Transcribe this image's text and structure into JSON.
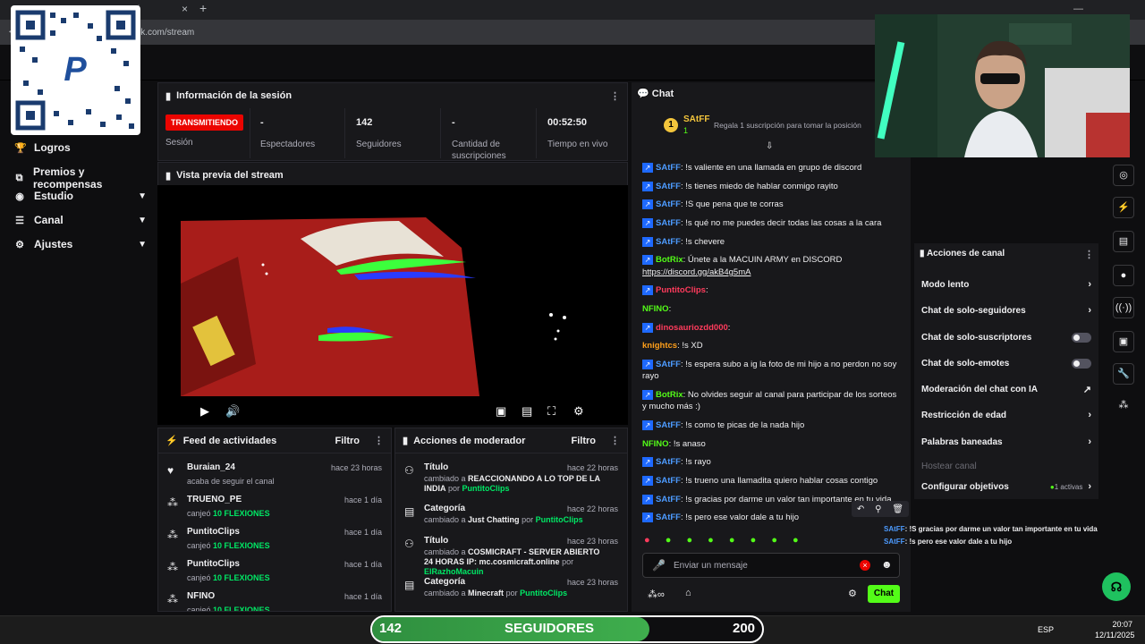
{
  "browser": {
    "url": "ick.com/stream",
    "tab_fragment": "rd"
  },
  "sidebar": {
    "items": [
      {
        "label": "Logros",
        "icon": "trophy-icon"
      },
      {
        "label": "Premios y recompensas",
        "icon": "gift-icon"
      },
      {
        "label": "Estudio",
        "icon": "studio-icon"
      },
      {
        "label": "Canal",
        "icon": "channel-icon"
      },
      {
        "label": "Ajustes",
        "icon": "gear-icon"
      }
    ]
  },
  "session": {
    "title": "Información de la sesión",
    "badge": "TRANSMITIENDO",
    "badge_label": "Sesión",
    "viewers_val": "-",
    "viewers_lbl": "Espectadores",
    "followers_val": "142",
    "followers_lbl": "Seguidores",
    "subs_val": "-",
    "subs_lbl": "Cantidad de suscripciones",
    "live_val": "00:52:50",
    "live_lbl": "Tiempo en vivo"
  },
  "preview": {
    "title": "Vista previa del stream"
  },
  "activity": {
    "title": "Feed de actividades",
    "filter": "Filtro",
    "rows": [
      {
        "name": "Buraian_24",
        "desc": "acaba de seguir el canal",
        "hl": "",
        "time": "hace 23 horas",
        "icon": "heart-icon"
      },
      {
        "name": "TRUENO_PE",
        "desc": "canjeó",
        "hl": "10 FLEXIONES",
        "time": "hace 1 día",
        "icon": "points-icon"
      },
      {
        "name": "PuntitoClips",
        "desc": "canjeó",
        "hl": "10 FLEXIONES",
        "time": "hace 1 día",
        "icon": "points-icon"
      },
      {
        "name": "PuntitoClips",
        "desc": "canjeó",
        "hl": "10 FLEXIONES",
        "time": "hace 1 día",
        "icon": "points-icon"
      },
      {
        "name": "NFINO",
        "desc": "canjeó",
        "hl": "10 FLEXIONES",
        "time": "hace 1 día",
        "icon": "points-icon"
      }
    ]
  },
  "modactions": {
    "title": "Acciones de moderador",
    "filter": "Filtro",
    "rows": [
      {
        "name": "Título",
        "l1": "cambiado a",
        "v1": "REACCIONANDO A LO TOP DE LA INDIA",
        "l2": "por",
        "v2": "PuntitoClips",
        "time": "hace 22 horas"
      },
      {
        "name": "Categoría",
        "l1": "cambiado a",
        "v1": "Just Chatting",
        "l2": "por",
        "v2": "PuntitoClips",
        "time": "hace 22 horas"
      },
      {
        "name": "Título",
        "l1": "cambiado a",
        "v1": "COSMICRAFT - SERVER ABIERTO 24 HORAS IP: mc.cosmicraft.online",
        "l2": "por",
        "v2": "ElRazhoMacuin",
        "time": "hace 23 horas"
      },
      {
        "name": "Categoría",
        "l1": "cambiado a",
        "v1": "Minecraft",
        "l2": "por",
        "v2": "PuntitoClips",
        "time": "hace 23 horas"
      }
    ]
  },
  "chat": {
    "title": "Chat",
    "pinned_user": "SAtFF",
    "pinned_count": "1",
    "gift_text": "Regala 1 suscripción para tomar la posición",
    "messages": [
      {
        "user": "SAtFF",
        "color": "#4d9bff",
        "text": "!s valiente en una llamada en grupo de discord"
      },
      {
        "user": "SAtFF",
        "color": "#4d9bff",
        "text": "!s tienes miedo de hablar conmigo rayito"
      },
      {
        "user": "SAtFF",
        "color": "#4d9bff",
        "text": "!S que pena que te corras"
      },
      {
        "user": "SAtFF",
        "color": "#4d9bff",
        "text": "!s qué no me puedes decir todas las cosas a la cara"
      },
      {
        "user": "SAtFF",
        "color": "#4d9bff",
        "text": "!s chevere"
      },
      {
        "user": "BotRix",
        "color": "#53fc18",
        "text": "Únete a la MACUIN ARMY en DISCORD"
      },
      {
        "user": "",
        "color": "#efeff1",
        "text": "https://discord.gg/akB4g5mA"
      },
      {
        "user": "PuntitoClips",
        "color": "#ff3b5c",
        "text": ""
      },
      {
        "user": "NFINO",
        "color": "#53fc18",
        "text": ""
      },
      {
        "user": "dinosauriozdd000",
        "color": "#ff3b5c",
        "text": ""
      },
      {
        "user": "knightcs",
        "color": "#ff9f1a",
        "text": "!s XD"
      },
      {
        "user": "SAtFF",
        "color": "#4d9bff",
        "text": "!s espera subo a ig la foto de mi hijo a no perdon no soy rayo"
      },
      {
        "user": "BotRix",
        "color": "#53fc18",
        "text": "No olvides seguir al canal para participar de los sorteos y mucho más :)"
      },
      {
        "user": "SAtFF",
        "color": "#4d9bff",
        "text": "!s como te picas de la nada hijo"
      },
      {
        "user": "NFINO",
        "color": "#53fc18",
        "text": "!s anaso"
      },
      {
        "user": "SAtFF",
        "color": "#4d9bff",
        "text": "!s rayo"
      },
      {
        "user": "SAtFF",
        "color": "#4d9bff",
        "text": "!s trueno una llamadita quiero hablar cosas contigo"
      },
      {
        "user": "SAtFF",
        "color": "#4d9bff",
        "text": "!s gracias por darme un valor tan importante en tu vida"
      },
      {
        "user": "SAtFF",
        "color": "#4d9bff",
        "text": "!s pero ese valor dale a tu hijo"
      }
    ],
    "input_placeholder": "Enviar un mensaje",
    "send_label": "Chat"
  },
  "overlay_chat": [
    {
      "user": "SAtFF",
      "text": ": !S gracias por darme un valor tan importante en tu vida"
    },
    {
      "user": "SAtFF",
      "text": ": !s pero ese valor dale a tu hijo"
    }
  ],
  "channel_actions": {
    "title": "Acciones de canal",
    "items": [
      {
        "label": "Modo lento",
        "ctrl": "chevron"
      },
      {
        "label": "Chat de solo-seguidores",
        "ctrl": "chevron"
      },
      {
        "label": "Chat de solo-suscriptores",
        "ctrl": "toggle"
      },
      {
        "label": "Chat de solo-emotes",
        "ctrl": "toggle"
      },
      {
        "label": "Moderación del chat con IA",
        "ctrl": "external"
      },
      {
        "label": "Restricción de edad",
        "ctrl": "chevron"
      },
      {
        "label": "Palabras baneadas",
        "ctrl": "chevron"
      },
      {
        "label": "Hostear canal",
        "ctrl": "none"
      },
      {
        "label": "Configurar objetivos",
        "ctrl": "chevron"
      }
    ],
    "goals_active": "1 activas"
  },
  "overlay_goal": {
    "count": "142",
    "label": "SEGUIDORES",
    "target": "200",
    "progress": 0.71
  },
  "taskbar": {
    "lang": "ESP",
    "time": "20:07",
    "date": "12/11/2025"
  },
  "colors": {
    "accent_green": "#53fc18",
    "live_red": "#eb0400",
    "panel": "#18181b"
  }
}
